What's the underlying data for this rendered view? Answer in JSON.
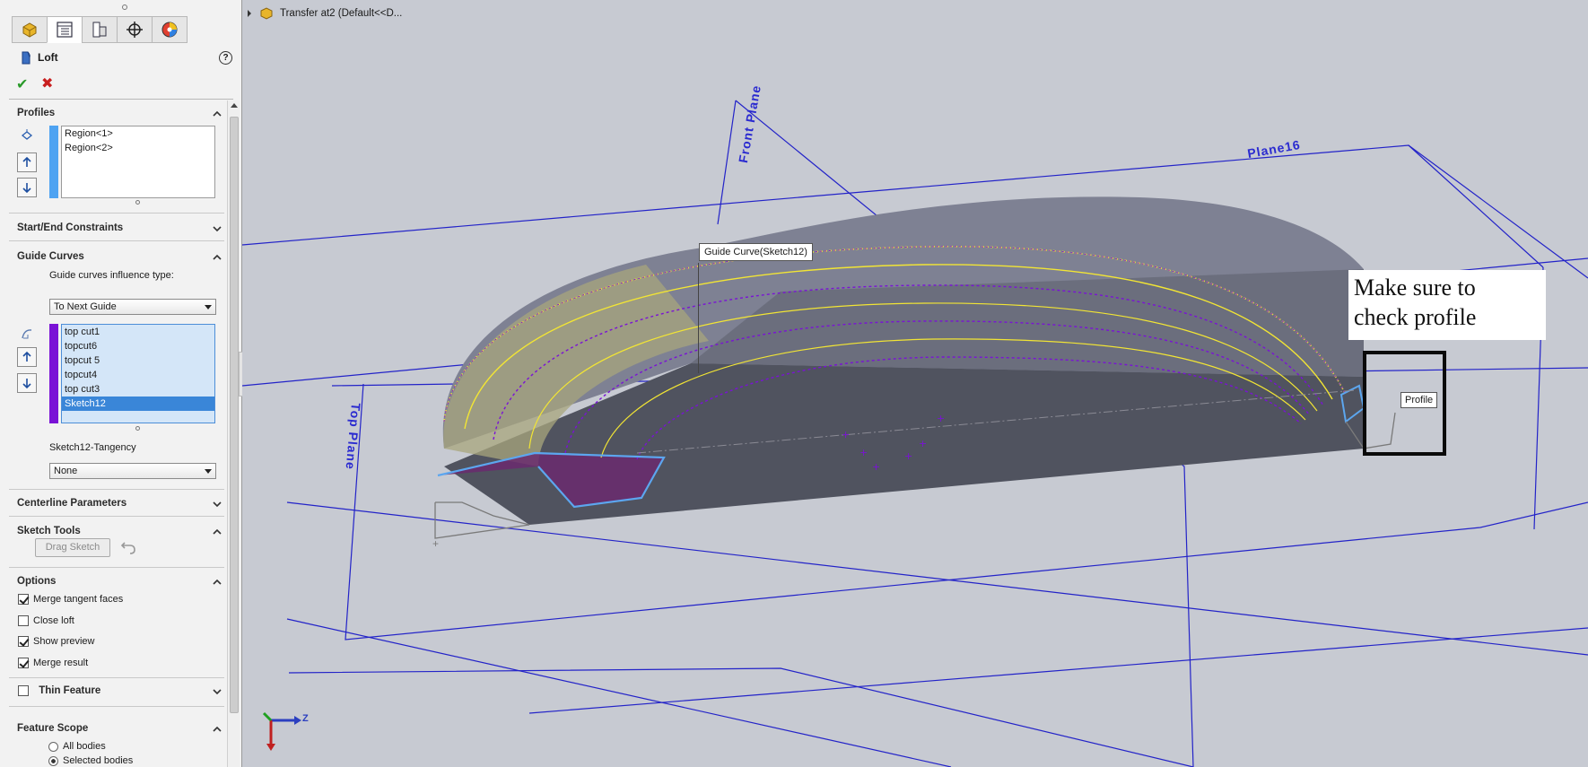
{
  "feature": {
    "title": "Loft"
  },
  "tabs": [
    "feature-manager",
    "property-manager",
    "configuration-manager",
    "dimxpert-manager",
    "display-manager"
  ],
  "sections": {
    "profiles": {
      "label": "Profiles",
      "items": [
        "Region<1>",
        "Region<2>"
      ]
    },
    "start_end": {
      "label": "Start/End Constraints"
    },
    "guide_curves": {
      "label": "Guide Curves",
      "influence_label": "Guide curves influence type:",
      "influence_value": "To Next Guide",
      "items": [
        "top cut1",
        "topcut6",
        "topcut 5",
        "topcut4",
        "top cut3",
        "Sketch12"
      ],
      "selected": "Sketch12",
      "tangency_label": "Sketch12-Tangency",
      "tangency_value": "None"
    },
    "centerline": {
      "label": "Centerline Parameters"
    },
    "sketch_tools": {
      "label": "Sketch Tools",
      "drag_sketch": "Drag Sketch"
    },
    "options": {
      "label": "Options",
      "merge_tangent": "Merge tangent faces",
      "close_loft": "Close loft",
      "show_preview": "Show preview",
      "merge_result": "Merge result"
    },
    "thin_feature": {
      "label": "Thin Feature"
    },
    "feature_scope": {
      "label": "Feature Scope",
      "all_bodies": "All bodies",
      "selected_bodies": "Selected bodies"
    }
  },
  "viewport": {
    "tree_item": "Transfer at2  (Default<<D...",
    "tooltip_guide": "Guide Curve(Sketch12)",
    "tooltip_profile": "Profile",
    "annotation_line1": "Make sure to",
    "annotation_line2": "check profile",
    "planes": {
      "front": "Front Plane",
      "top": "Top Plane",
      "plane16": "Plane16"
    },
    "triad": {
      "y": "Y",
      "z": "Z"
    }
  },
  "colors": {
    "accent_blue": "#4d8ed8",
    "profile_bar": "#4ea3f2",
    "guide_bar": "#7a12d6",
    "ok": "#2a9a2a",
    "cancel": "#c81e1e",
    "plane": "#2a2ad0"
  }
}
